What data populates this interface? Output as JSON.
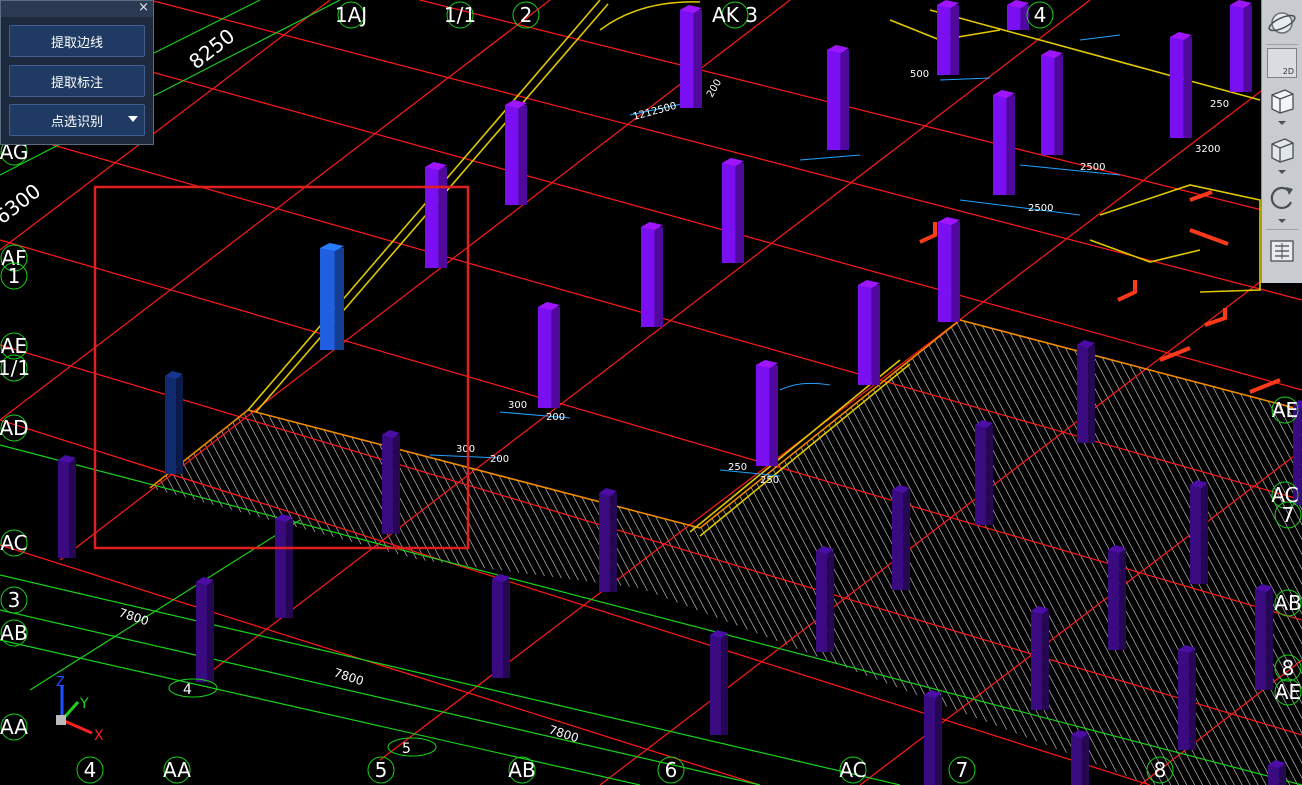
{
  "panel": {
    "close_label": "×",
    "buttons": [
      {
        "label": "提取边线"
      },
      {
        "label": "提取标注"
      },
      {
        "label": "点选识别"
      }
    ]
  },
  "toolbar": {
    "view_2d_label": "2D",
    "icons": [
      "orbit-icon",
      "view-2d-icon",
      "view-3d-icon",
      "view-box-icon",
      "rotate-icon",
      "layer-list-icon"
    ]
  },
  "axis_bubbles": {
    "top": [
      "1AJ",
      "1/1",
      "2",
      "AK 3",
      "4"
    ],
    "left": [
      "AG",
      "AF",
      "1",
      "AE",
      "1/1",
      "AD",
      "AC",
      "3",
      "AB",
      "AA"
    ],
    "bottom": [
      "4",
      "AA",
      "5",
      "AB",
      "6",
      "AC",
      "7",
      "8"
    ],
    "right": [
      "AE",
      "AC",
      "7",
      "AB",
      "8",
      "AE"
    ],
    "floating": [
      "4",
      "5"
    ]
  },
  "dimensions": {
    "large": [
      "8250",
      "6300"
    ],
    "spans": [
      "7800",
      "7800",
      "7800"
    ],
    "small": [
      "300",
      "200",
      "300",
      "200",
      "250",
      "250",
      "500",
      "2500",
      "2500",
      "1212500",
      "200",
      "3200",
      "250"
    ]
  },
  "ucs": {
    "x_label": "X",
    "y_label": "Y",
    "z_label": "Z"
  },
  "colors": {
    "background": "#000000",
    "axis_grid": "#ff1a1a",
    "green_grid": "#19d219",
    "column_purple": "#7a10f2",
    "column_dark": "#3a0a80",
    "column_selected": "#1f5fe0",
    "column_navy": "#102a70",
    "selection_box": "#e02020",
    "beam_yellow": "#e0c800",
    "beam_orange": "#f08a00",
    "dimension_cyan": "#1fa3ff",
    "hatch": "#ffffff",
    "panel_bg": "#1d2a3d",
    "button_bg": "#1f3b63"
  }
}
